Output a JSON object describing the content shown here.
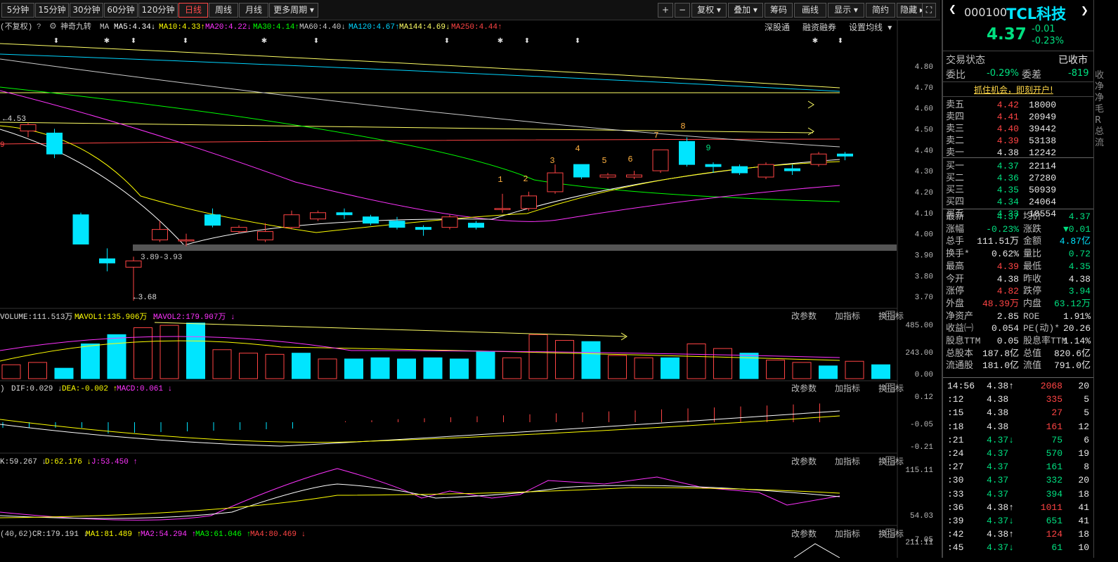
{
  "toolbar": {
    "periods": [
      "5分钟",
      "15分钟",
      "30分钟",
      "60分钟",
      "120分钟",
      "日线",
      "周线",
      "月线",
      "更多周期"
    ],
    "active_period": "日线",
    "right_tools": [
      "+",
      "−",
      "复权",
      "叠加",
      "筹码",
      "画线",
      "显示",
      "简约",
      "隐藏"
    ]
  },
  "ma_bar": {
    "fq": "不复权",
    "help": "?",
    "indicator": "神奇九转",
    "ma_label": "MA",
    "items": [
      {
        "text": "MA5:4.34",
        "color": "#ffffff"
      },
      {
        "text": "MA10:4.33",
        "color": "#ffff00"
      },
      {
        "text": "MA20:4.22",
        "color": "#ff33ff"
      },
      {
        "text": "MA30:4.14",
        "color": "#00ff00"
      },
      {
        "text": "MA60:4.40",
        "color": "#cccccc"
      },
      {
        "text": "MA120:4.67",
        "color": "#00d5ff"
      },
      {
        "text": "MA144:4.69",
        "color": "#ffff66"
      },
      {
        "text": "MA250:4.44",
        "color": "#ff4444"
      }
    ],
    "links": [
      "深股通",
      "融资融券",
      "设置均线"
    ]
  },
  "price_axis": [
    "4.80",
    "4.70",
    "4.60",
    "4.50",
    "4.40",
    "4.30",
    "4.20",
    "4.10",
    "4.00",
    "3.90",
    "3.80",
    "3.70"
  ],
  "annotations": {
    "high_mark": "4.53",
    "low_mark": "3.68",
    "gap_label": "3.89-3.93",
    "left_nine": "9"
  },
  "nine_turn": [
    "1",
    "2",
    "3",
    "4",
    "5",
    "6",
    "7",
    "8",
    "9"
  ],
  "volume": {
    "title": "VOLUME:111.513万",
    "mavol1": "MAVOL1:135.906万",
    "mavol2": "MAVOL2:179.907万",
    "axis": [
      "485.00",
      "243.00",
      "0.00"
    ],
    "panel_buttons": [
      "改参数",
      "加指标",
      "换指标"
    ]
  },
  "macd": {
    "dif": "DIF:0.029",
    "dea": "DEA:-0.002",
    "macd": "MACD:0.061",
    "axis": [
      "0.12",
      "-0.05",
      "-0.21"
    ]
  },
  "kdj": {
    "k": "K:59.267",
    "d": "D:62.176",
    "j": "J:53.450",
    "axis": [
      "115.11",
      "54.03",
      "-7.05"
    ]
  },
  "cr": {
    "params": "(40,62)",
    "cr": "CR:179.191",
    "ma1": "MA1:81.489",
    "ma2": "MA2:54.294",
    "ma3": "MA3:61.046",
    "ma4": "MA4:80.469",
    "axis": [
      "211.11"
    ]
  },
  "stock": {
    "code": "000100",
    "name": "TCL科技",
    "price": "4.37",
    "change": "-0.01",
    "change_pct": "-0.23%",
    "trade_status_label": "交易状态",
    "trade_status": "已收市",
    "weibi_label": "委比",
    "weibi": "-0.29%",
    "weicha_label": "委差",
    "weicha": "-819",
    "promo": "抓住机会，即刻开户!"
  },
  "order_book": {
    "sells": [
      {
        "label": "卖五",
        "price": "4.42",
        "vol": "18000"
      },
      {
        "label": "卖四",
        "price": "4.41",
        "vol": "20949"
      },
      {
        "label": "卖三",
        "price": "4.40",
        "vol": "39442"
      },
      {
        "label": "卖二",
        "price": "4.39",
        "vol": "53138"
      },
      {
        "label": "卖一",
        "price": "4.38",
        "vol": "12242"
      }
    ],
    "buys": [
      {
        "label": "买一",
        "price": "4.37",
        "vol": "22114"
      },
      {
        "label": "买二",
        "price": "4.36",
        "vol": "27280"
      },
      {
        "label": "买三",
        "price": "4.35",
        "vol": "50939"
      },
      {
        "label": "买四",
        "price": "4.34",
        "vol": "24064"
      },
      {
        "label": "买五",
        "price": "4.33",
        "vol": "18554"
      }
    ]
  },
  "quote_stats": [
    {
      "l1": "最新",
      "v1": "4.37",
      "c1": "green",
      "l2": "均价",
      "v2": "4.37",
      "c2": "green"
    },
    {
      "l1": "涨幅",
      "v1": "-0.23%",
      "c1": "green",
      "l2": "涨跌",
      "v2": "▼0.01",
      "c2": "green"
    },
    {
      "l1": "总手",
      "v1": "111.51万",
      "c1": "white",
      "l2": "金额",
      "v2": "4.87亿",
      "c2": "cyan"
    },
    {
      "l1": "换手*",
      "v1": "0.62%",
      "c1": "white",
      "l2": "量比",
      "v2": "0.72",
      "c2": "green"
    },
    {
      "l1": "最高",
      "v1": "4.39",
      "c1": "red",
      "l2": "最低",
      "v2": "4.35",
      "c2": "green"
    },
    {
      "l1": "今开",
      "v1": "4.38",
      "c1": "white",
      "l2": "昨收",
      "v2": "4.38",
      "c2": "white"
    },
    {
      "l1": "涨停",
      "v1": "4.82",
      "c1": "red",
      "l2": "跌停",
      "v2": "3.94",
      "c2": "green"
    },
    {
      "l1": "外盘",
      "v1": "48.39万",
      "c1": "red",
      "l2": "内盘",
      "v2": "63.12万",
      "c2": "green"
    },
    {
      "l1": "净资产",
      "v1": "2.85",
      "c1": "white",
      "l2": "ROE",
      "v2": "1.91%",
      "c2": "white"
    },
    {
      "l1": "收益㈠",
      "v1": "0.054",
      "c1": "white",
      "l2": "PE(动)*",
      "v2": "20.26",
      "c2": "white"
    },
    {
      "l1": "股息TTM",
      "v1": "0.05",
      "c1": "white",
      "l2": "股息率TTM",
      "v2": "1.14%",
      "c2": "white"
    },
    {
      "l1": "总股本",
      "v1": "187.8亿",
      "c1": "white",
      "l2": "总值",
      "v2": "820.6亿",
      "c2": "white"
    },
    {
      "l1": "流通股",
      "v1": "181.0亿",
      "c1": "white",
      "l2": "流值",
      "v2": "791.0亿",
      "c2": "white"
    }
  ],
  "ticks": [
    {
      "time": "14:56",
      "price": "4.38",
      "arrow": "↑",
      "vol": "2068",
      "n": "20",
      "dir": "red"
    },
    {
      "time": ":12",
      "price": "4.38",
      "arrow": "",
      "vol": "335",
      "n": "5",
      "dir": "red"
    },
    {
      "time": ":15",
      "price": "4.38",
      "arrow": "",
      "vol": "27",
      "n": "5",
      "dir": "red"
    },
    {
      "time": ":18",
      "price": "4.38",
      "arrow": "",
      "vol": "161",
      "n": "12",
      "dir": "red"
    },
    {
      "time": ":21",
      "price": "4.37",
      "arrow": "↓",
      "vol": "75",
      "n": "6",
      "dir": "green"
    },
    {
      "time": ":24",
      "price": "4.37",
      "arrow": "",
      "vol": "570",
      "n": "19",
      "dir": "green"
    },
    {
      "time": ":27",
      "price": "4.37",
      "arrow": "",
      "vol": "161",
      "n": "8",
      "dir": "green"
    },
    {
      "time": ":30",
      "price": "4.37",
      "arrow": "",
      "vol": "332",
      "n": "20",
      "dir": "green"
    },
    {
      "time": ":33",
      "price": "4.37",
      "arrow": "",
      "vol": "394",
      "n": "18",
      "dir": "green"
    },
    {
      "time": ":36",
      "price": "4.38",
      "arrow": "↑",
      "vol": "1011",
      "n": "41",
      "dir": "red"
    },
    {
      "time": ":39",
      "price": "4.37",
      "arrow": "↓",
      "vol": "651",
      "n": "41",
      "dir": "green"
    },
    {
      "time": ":42",
      "price": "4.38",
      "arrow": "↑",
      "vol": "124",
      "n": "18",
      "dir": "red"
    },
    {
      "time": ":45",
      "price": "4.37",
      "arrow": "↓",
      "vol": "61",
      "n": "10",
      "dir": "green"
    }
  ],
  "colors": {
    "up": "#ff4444",
    "down": "#00e5ff",
    "bg": "#000000"
  },
  "chart_data": {
    "type": "candlestick",
    "ylim": [
      3.65,
      4.85
    ],
    "candles": [
      {
        "o": 4.49,
        "c": 4.52,
        "h": 4.53,
        "l": 4.46
      },
      {
        "o": 4.48,
        "c": 4.38,
        "h": 4.5,
        "l": 4.36
      },
      {
        "o": 4.09,
        "c": 3.95,
        "h": 4.1,
        "l": 3.95
      },
      {
        "o": 3.88,
        "c": 3.86,
        "h": 3.93,
        "l": 3.82
      },
      {
        "o": 3.84,
        "c": 3.87,
        "h": 3.89,
        "l": 3.68
      },
      {
        "o": 3.97,
        "c": 4.02,
        "h": 4.06,
        "l": 3.96
      },
      {
        "o": 3.97,
        "c": 3.97,
        "h": 4.0,
        "l": 3.94
      },
      {
        "o": 4.09,
        "c": 4.04,
        "h": 4.12,
        "l": 4.03
      },
      {
        "o": 4.01,
        "c": 4.03,
        "h": 4.04,
        "l": 4.0
      },
      {
        "o": 3.97,
        "c": 4.01,
        "h": 4.05,
        "l": 3.96
      },
      {
        "o": 4.03,
        "c": 4.09,
        "h": 4.11,
        "l": 4.02
      },
      {
        "o": 4.07,
        "c": 4.1,
        "h": 4.11,
        "l": 4.06
      },
      {
        "o": 4.1,
        "c": 4.09,
        "h": 4.12,
        "l": 4.07
      },
      {
        "o": 4.08,
        "c": 4.05,
        "h": 4.09,
        "l": 4.04
      },
      {
        "o": 4.06,
        "c": 4.03,
        "h": 4.08,
        "l": 4.02
      },
      {
        "o": 4.03,
        "c": 4.02,
        "h": 4.04,
        "l": 3.99
      },
      {
        "o": 4.03,
        "c": 4.08,
        "h": 4.09,
        "l": 4.02
      },
      {
        "o": 4.05,
        "c": 4.03,
        "h": 4.06,
        "l": 4.02
      },
      {
        "o": 4.12,
        "c": 4.12,
        "h": 4.19,
        "l": 4.1
      },
      {
        "o": 4.12,
        "c": 4.18,
        "h": 4.2,
        "l": 4.11
      },
      {
        "o": 4.2,
        "c": 4.29,
        "h": 4.33,
        "l": 4.19
      },
      {
        "o": 4.33,
        "c": 4.27,
        "h": 4.33,
        "l": 4.26
      },
      {
        "o": 4.27,
        "c": 4.28,
        "h": 4.29,
        "l": 4.26
      },
      {
        "o": 4.27,
        "c": 4.28,
        "h": 4.3,
        "l": 4.26
      },
      {
        "o": 4.3,
        "c": 4.4,
        "h": 4.4,
        "l": 4.29
      },
      {
        "o": 4.44,
        "c": 4.33,
        "h": 4.46,
        "l": 4.32
      },
      {
        "o": 4.33,
        "c": 4.32,
        "h": 4.34,
        "l": 4.29
      },
      {
        "o": 4.32,
        "c": 4.29,
        "h": 4.33,
        "l": 4.28
      },
      {
        "o": 4.27,
        "c": 4.33,
        "h": 4.34,
        "l": 4.26
      },
      {
        "o": 4.31,
        "c": 4.3,
        "h": 4.33,
        "l": 4.28
      },
      {
        "o": 4.33,
        "c": 4.38,
        "h": 4.39,
        "l": 4.32
      },
      {
        "o": 4.38,
        "c": 4.37,
        "h": 4.39,
        "l": 4.35
      }
    ],
    "volumes": [
      120,
      140,
      90,
      300,
      380,
      440,
      460,
      480,
      250,
      220,
      210,
      220,
      170,
      170,
      180,
      170,
      180,
      170,
      230,
      180,
      380,
      330,
      320,
      200,
      180,
      180,
      300,
      260,
      220,
      160,
      140,
      110,
      150,
      120
    ]
  }
}
